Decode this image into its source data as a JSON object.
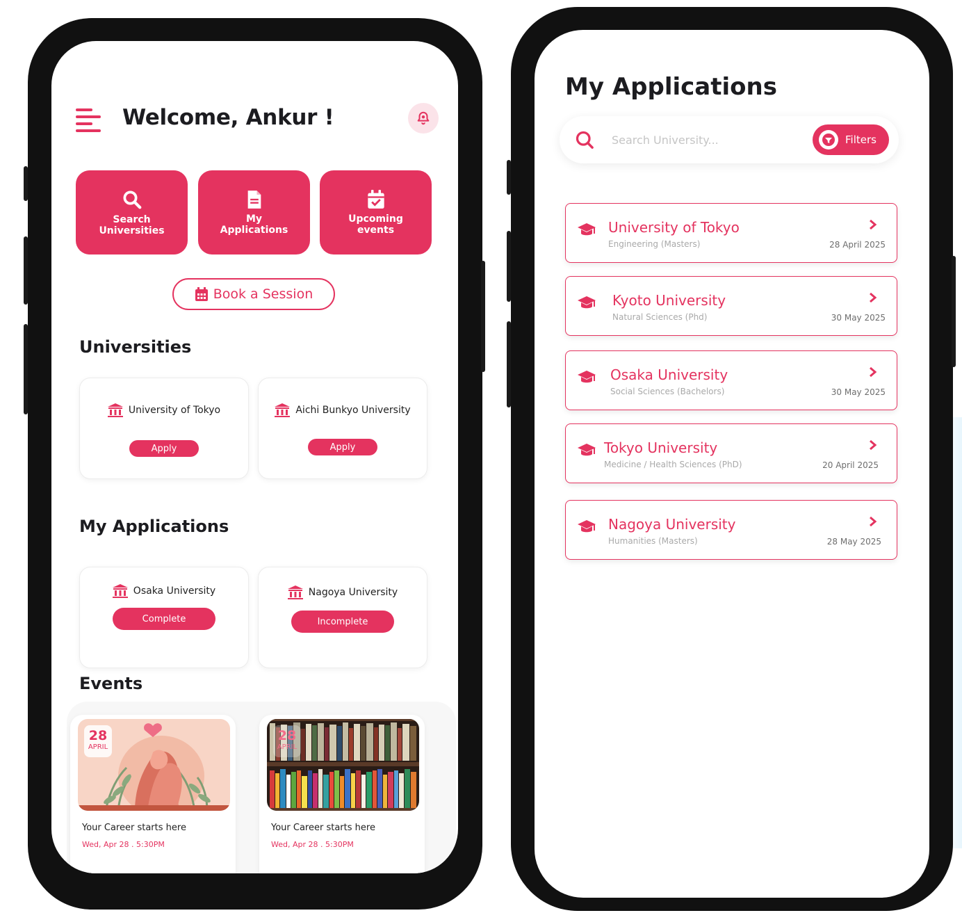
{
  "colors": {
    "brand": "#e4335f",
    "text": "#1c1c20",
    "muted": "#a9a9a9"
  },
  "home": {
    "header": {
      "menu_icon": "hamburger-icon",
      "welcome": "Welcome, Ankur !",
      "bell_icon": "bell-icon"
    },
    "quick_actions": [
      {
        "label": "Search Universities",
        "icon": "search-icon"
      },
      {
        "label": "My Applications",
        "icon": "document-icon"
      },
      {
        "label": "Upcoming events",
        "icon": "calendar-check-icon"
      }
    ],
    "book_session": {
      "label": "Book a Session",
      "icon": "calendar-icon"
    },
    "universities": {
      "title": "Universities",
      "items": [
        {
          "name": "University of Tokyo",
          "action": "Apply"
        },
        {
          "name": "Aichi Bunkyo University",
          "action": "Apply"
        }
      ]
    },
    "applications": {
      "title": "My Applications",
      "items": [
        {
          "name": "Osaka University",
          "status": "Complete"
        },
        {
          "name": "Nagoya University",
          "status": "Incomplete"
        }
      ]
    },
    "events": {
      "title": "Events",
      "items": [
        {
          "day": "28",
          "month": "APRIL",
          "title": "Your Career starts here",
          "when": "Wed, Apr 28 . 5:30PM"
        },
        {
          "day": "28",
          "month": "APRIL",
          "title": "Your Career starts here",
          "when": "Wed, Apr 28 . 5:30PM"
        }
      ]
    }
  },
  "applications_page": {
    "title": "My Applications",
    "search": {
      "placeholder": "Search University...",
      "filters_label": "Filters"
    },
    "items": [
      {
        "name": "University of Tokyo",
        "program": "Engineering (Masters)",
        "date": "28 April 2025"
      },
      {
        "name": "Kyoto University",
        "program": "Natural Sciences (Phd)",
        "date": "30 May 2025"
      },
      {
        "name": "Osaka University",
        "program": "Social Sciences (Bachelors)",
        "date": "30 May 2025"
      },
      {
        "name": "Tokyo University",
        "program": "Medicine / Health Sciences (PhD)",
        "date": "20 April 2025"
      },
      {
        "name": "Nagoya University",
        "program": "Humanities (Masters)",
        "date": "28 May 2025"
      }
    ]
  }
}
